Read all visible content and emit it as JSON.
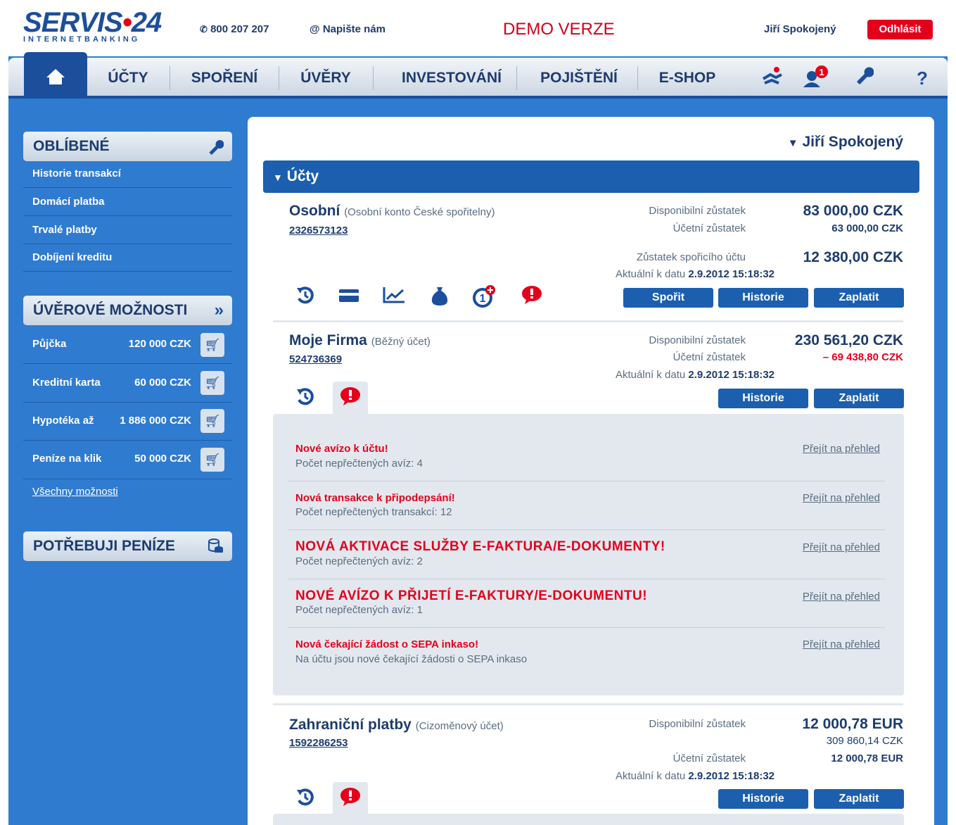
{
  "header": {
    "brand_main": "SERVIS",
    "brand_dot": "•",
    "brand_num": "24",
    "brand_sub": "INTERNETBANKING",
    "phone": "800 207 207",
    "email": "Napište nám",
    "demo": "DEMO VERZE",
    "user": "Jiří Spokojený",
    "logout": "Odhlásit"
  },
  "nav": {
    "items": [
      "ÚČTY",
      "SPOŘENÍ",
      "ÚVĚRY",
      "INVESTOVÁNÍ",
      "POJIŠTĚNÍ",
      "E-SHOP"
    ],
    "help": "?",
    "notification_count": "1"
  },
  "sidebar": {
    "favorites_title": "OBLÍBENÉ",
    "favorites": [
      "Historie transakcí",
      "Domácí platba",
      "Trvalé platby",
      "Dobíjení kreditu"
    ],
    "credit_title": "ÚVĚROVÉ MOŽNOSTI",
    "credit_items": [
      {
        "label": "Půjčka",
        "amount": "120 000 CZK"
      },
      {
        "label": "Kreditní karta",
        "amount": "60 000 CZK"
      },
      {
        "label": "Hypotéka až",
        "amount": "1 886 000 CZK"
      },
      {
        "label": "Peníze na klik",
        "amount": "50 000 CZK"
      }
    ],
    "all_options": "Všechny možnosti",
    "money_title": "POTŘEBUJI PENÍZE"
  },
  "main": {
    "user": "Jiří Spokojený",
    "section_title": "Účty",
    "accounts": [
      {
        "name": "Osobní",
        "type": "(Osobní konto České spořitelny)",
        "number": "2326573123",
        "available_label": "Disponibilní zůstatek",
        "available": "83 000,00 CZK",
        "ledger_label": "Účetní zůstatek",
        "ledger": "63 000,00 CZK",
        "savings_label": "Zůstatek spořicího účtu",
        "savings": "12 380,00 CZK",
        "asof_label": "Aktuální k datu",
        "asof": "2.9.2012 15:18:32",
        "buttons": [
          "Spořit",
          "Historie",
          "Zaplatit"
        ]
      },
      {
        "name": "Moje Firma",
        "type": "(Běžný účet)",
        "number": "524736369",
        "available_label": "Disponibilní zůstatek",
        "available": "230 561,20 CZK",
        "ledger_label": "Účetní zůstatek",
        "ledger": "– 69 438,80 CZK",
        "asof_label": "Aktuální k datu",
        "asof": "2.9.2012 15:18:32",
        "buttons": [
          "Historie",
          "Zaplatit"
        ]
      },
      {
        "name": "Zahraniční platby",
        "type": "(Cizoměnový účet)",
        "number": "1592286253",
        "available_label": "Disponibilní zůstatek",
        "available": "12 000,78 EUR",
        "available_czk": "309 860,14 CZK",
        "ledger_label": "Účetní zůstatek",
        "ledger": "12 000,78 EUR",
        "asof_label": "Aktuální k datu",
        "asof": "2.9.2012 15:18:32",
        "buttons": [
          "Historie",
          "Zaplatit"
        ]
      }
    ],
    "messages": [
      {
        "title": "Nové avízo k účtu!",
        "sub": "Počet nepřečtených avíz: 4",
        "link": "Přejít na přehled"
      },
      {
        "title": "Nová transakce k připodepsání!",
        "sub": "Počet nepřečtených transakcí: 12",
        "link": "Přejít na přehled"
      },
      {
        "title": "NOVÁ AKTIVACE SLUŽBY E-FAKTURA/E-DOKUMENTY!",
        "sub": "Počet nepřečtených avíz: 2",
        "link": "Přejít na přehled"
      },
      {
        "title": "NOVÉ AVÍZO K PŘIJETÍ E-FAKTURY/E-DOKUMENTU!",
        "sub": "Počet nepřečtených avíz: 1",
        "link": "Přejít na přehled"
      },
      {
        "title": "Nová čekající žádost o SEPA inkaso!",
        "sub": "Na účtu jsou nové čekající žádosti o SEPA inkaso",
        "link": "Přejít na přehled"
      }
    ]
  },
  "colors": {
    "brand": "#1b4f9c",
    "accent": "#e3001b",
    "sidebar": "#2f7bd0"
  }
}
